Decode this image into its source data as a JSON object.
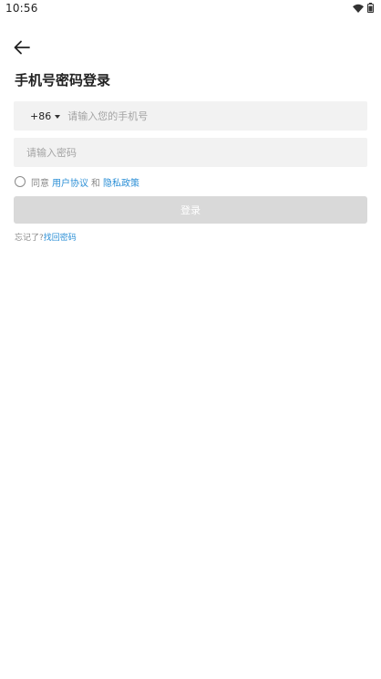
{
  "status_bar": {
    "time": "10:56",
    "icons": [
      "wifi-icon",
      "battery-icon"
    ]
  },
  "header": {
    "back_icon": "arrow-left-icon",
    "title": "手机号密码登录"
  },
  "form": {
    "country_code": "+86",
    "phone_placeholder": "请输入您的手机号",
    "phone_value": "",
    "password_placeholder": "请输入密码",
    "password_value": ""
  },
  "agreement": {
    "checked": false,
    "prefix": "同意",
    "user_agreement": "用户协议",
    "and": "和",
    "privacy_policy": "隐私政策"
  },
  "login_button": {
    "label": "登录",
    "enabled": false
  },
  "forgot": {
    "prefix": "忘记了?",
    "link": "找回密码"
  },
  "colors": {
    "link": "#2b8fd6",
    "field_bg": "#f2f2f2",
    "button_disabled_bg": "#d9d9d9",
    "muted_text": "#8a8a8a",
    "placeholder": "#a4a4a4"
  }
}
